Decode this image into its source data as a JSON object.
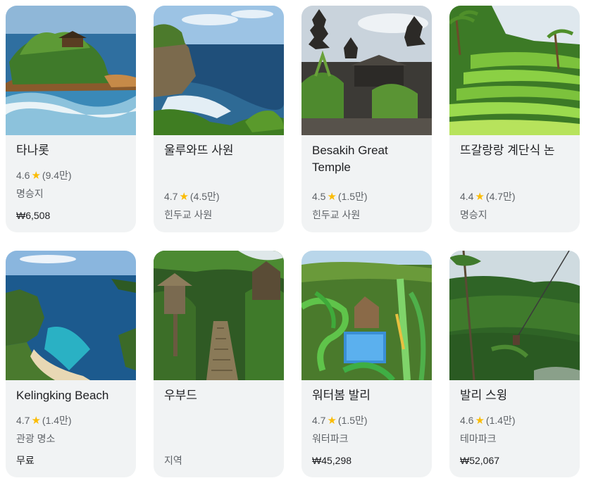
{
  "places": [
    {
      "name": "타나롯",
      "rating": "4.6",
      "reviews": "(9.4만)",
      "category": "명승지",
      "price": "₩6,508"
    },
    {
      "name": "울루와뜨 사원",
      "rating": "4.7",
      "reviews": "(4.5만)",
      "category": "힌두교 사원"
    },
    {
      "name": "Besakih Great Temple",
      "rating": "4.5",
      "reviews": "(1.5만)",
      "category": "힌두교 사원"
    },
    {
      "name": "뜨갈랑랑 계단식 논",
      "rating": "4.4",
      "reviews": "(4.7만)",
      "category": "명승지"
    },
    {
      "name": "Kelingking Beach",
      "rating": "4.7",
      "reviews": "(1.4만)",
      "category": "관광 명소",
      "price": "무료"
    },
    {
      "name": "우부드",
      "category": "지역"
    },
    {
      "name": "워터봄 발리",
      "rating": "4.7",
      "reviews": "(1.5만)",
      "category": "워터파크",
      "price": "₩45,298"
    },
    {
      "name": "발리 스윙",
      "rating": "4.6",
      "reviews": "(1.4만)",
      "category": "테마파크",
      "price": "₩52,067"
    }
  ],
  "star_glyph": "★",
  "colors": {
    "card_bg": "#f1f3f4",
    "star": "#fbbc04",
    "secondary_text": "#5f6368"
  }
}
